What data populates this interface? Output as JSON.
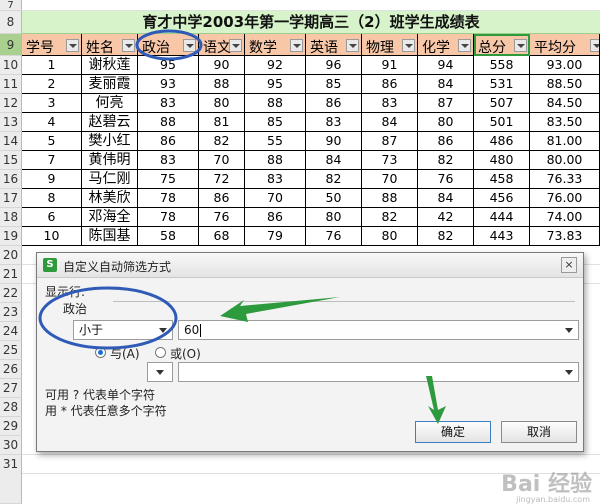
{
  "sheet": {
    "title": "育才中学2003年第一学期高三（2）班学生成绩表",
    "row_numbers": [
      "7",
      "8",
      "9",
      "10",
      "11",
      "12",
      "13",
      "14",
      "15",
      "16",
      "17",
      "18",
      "19",
      "20",
      "21",
      "22",
      "23",
      "24",
      "25",
      "26",
      "27",
      "28",
      "29",
      "30",
      "31"
    ],
    "headers": [
      "学号",
      "姓名",
      "政治",
      "语文",
      "数学",
      "英语",
      "物理",
      "化学",
      "总分",
      "平均分"
    ],
    "rows": [
      [
        "1",
        "谢秋莲",
        "95",
        "90",
        "92",
        "96",
        "91",
        "94",
        "558",
        "93.00"
      ],
      [
        "2",
        "麦丽霞",
        "93",
        "88",
        "95",
        "85",
        "86",
        "84",
        "531",
        "88.50"
      ],
      [
        "3",
        "何亮",
        "83",
        "80",
        "88",
        "86",
        "83",
        "87",
        "507",
        "84.50"
      ],
      [
        "4",
        "赵碧云",
        "88",
        "81",
        "85",
        "83",
        "84",
        "80",
        "501",
        "83.50"
      ],
      [
        "5",
        "樊小红",
        "86",
        "82",
        "55",
        "90",
        "87",
        "86",
        "486",
        "81.00"
      ],
      [
        "7",
        "黄伟明",
        "83",
        "70",
        "88",
        "84",
        "73",
        "82",
        "480",
        "80.00"
      ],
      [
        "9",
        "马仁刚",
        "75",
        "72",
        "83",
        "82",
        "70",
        "76",
        "458",
        "76.33"
      ],
      [
        "8",
        "林美欣",
        "78",
        "86",
        "70",
        "50",
        "88",
        "84",
        "456",
        "76.00"
      ],
      [
        "6",
        "邓海全",
        "78",
        "76",
        "86",
        "80",
        "82",
        "42",
        "444",
        "74.00"
      ],
      [
        "10",
        "陈国基",
        "58",
        "68",
        "79",
        "76",
        "80",
        "82",
        "443",
        "73.83"
      ]
    ]
  },
  "dialog": {
    "title": "自定义自动筛选方式",
    "show_rows_label": "显示行:",
    "field_label": "政治",
    "condition1_operator": "小于",
    "condition1_value": "60",
    "and_label": "与(A)",
    "or_label": "或(O)",
    "condition2_operator": "",
    "condition2_value": "",
    "hint1": "可用 ? 代表单个字符",
    "hint2": "用 * 代表任意多个字符",
    "ok_label": "确定",
    "cancel_label": "取消",
    "close_glyph": "×",
    "app_icon_letter": "S"
  },
  "watermark": {
    "text": "Bai 经验",
    "sub": "jingyan.baidu.com"
  },
  "colors": {
    "header_fill": "#f7c7a8",
    "title_fill": "#d6f3c9",
    "annotation": "#2f5bb7",
    "arrow": "#2e9a3e"
  }
}
